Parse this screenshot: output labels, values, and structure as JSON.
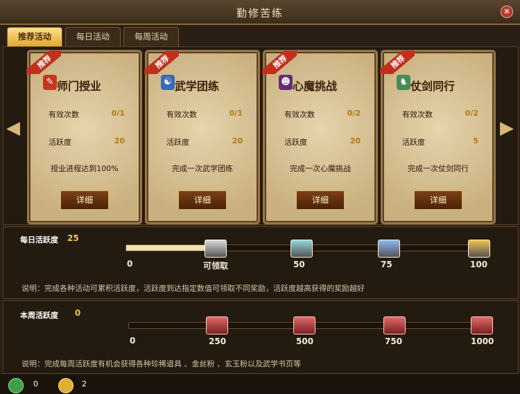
{
  "window": {
    "title": "勤修苦练"
  },
  "tabs": [
    {
      "label": "推荐活动"
    },
    {
      "label": "每日活动"
    },
    {
      "label": "每周活动"
    }
  ],
  "cards": [
    {
      "ribbon": "推荐",
      "title": "师门授业",
      "icon": "scroll-icon",
      "rows": [
        {
          "label": "有效次数",
          "value": "0/1"
        },
        {
          "label": "活跃度",
          "value": "20"
        }
      ],
      "desc": "授业进程达到100%",
      "button": "详细"
    },
    {
      "ribbon": "推荐",
      "title": "武学团练",
      "icon": "team-icon",
      "rows": [
        {
          "label": "有效次数",
          "value": "0/1"
        },
        {
          "label": "活跃度",
          "value": "20"
        }
      ],
      "desc": "完成一次武学团练",
      "button": "详细"
    },
    {
      "ribbon": "推荐",
      "title": "心魔挑战",
      "icon": "mask-icon",
      "rows": [
        {
          "label": "有效次数",
          "value": "0/2"
        },
        {
          "label": "活跃度",
          "value": "20"
        }
      ],
      "desc": "完成一次心魔挑战",
      "button": "详细"
    },
    {
      "ribbon": "推荐",
      "title": "仗剑同行",
      "icon": "swordsman-icon",
      "rows": [
        {
          "label": "有效次数",
          "value": "0/2"
        },
        {
          "label": "活跃度",
          "value": "5"
        }
      ],
      "desc": "完成一次仗剑同行",
      "button": "详细"
    }
  ],
  "daily": {
    "label": "每日活跃度",
    "value": "25",
    "progress": 0.25,
    "start": "0",
    "milestones": [
      {
        "label": "可领取",
        "color": "#d9d9d9"
      },
      {
        "label": "50",
        "color": "#8ed6e0"
      },
      {
        "label": "75",
        "color": "#8fb6f2"
      },
      {
        "label": "100",
        "color": "#f2c050"
      }
    ],
    "note": "说明：完成各种活动可累积活跃度，活跃度到达指定数值可领取不同奖励，活跃度越高获得的奖励越好"
  },
  "weekly": {
    "label": "本周活跃度",
    "value": "0",
    "progress": 0,
    "start": "0",
    "milestones": [
      {
        "label": "250",
        "color": "#e06a6a"
      },
      {
        "label": "500",
        "color": "#e06a6a"
      },
      {
        "label": "750",
        "color": "#e06a6a"
      },
      {
        "label": "1000",
        "color": "#e06a6a"
      }
    ],
    "note": "说明：完成每周活跃度有机会获得各种珍稀道具 、金丝粉 、玄玉粉以及武学书页等"
  },
  "currencies": [
    {
      "icon": "jade-coin-icon",
      "value": "0"
    },
    {
      "icon": "gold-coin-icon",
      "value": "2"
    }
  ],
  "colors": {
    "accent": "#f0c840",
    "ribbon": "#c0301c",
    "tab_active": "#e0a833"
  }
}
